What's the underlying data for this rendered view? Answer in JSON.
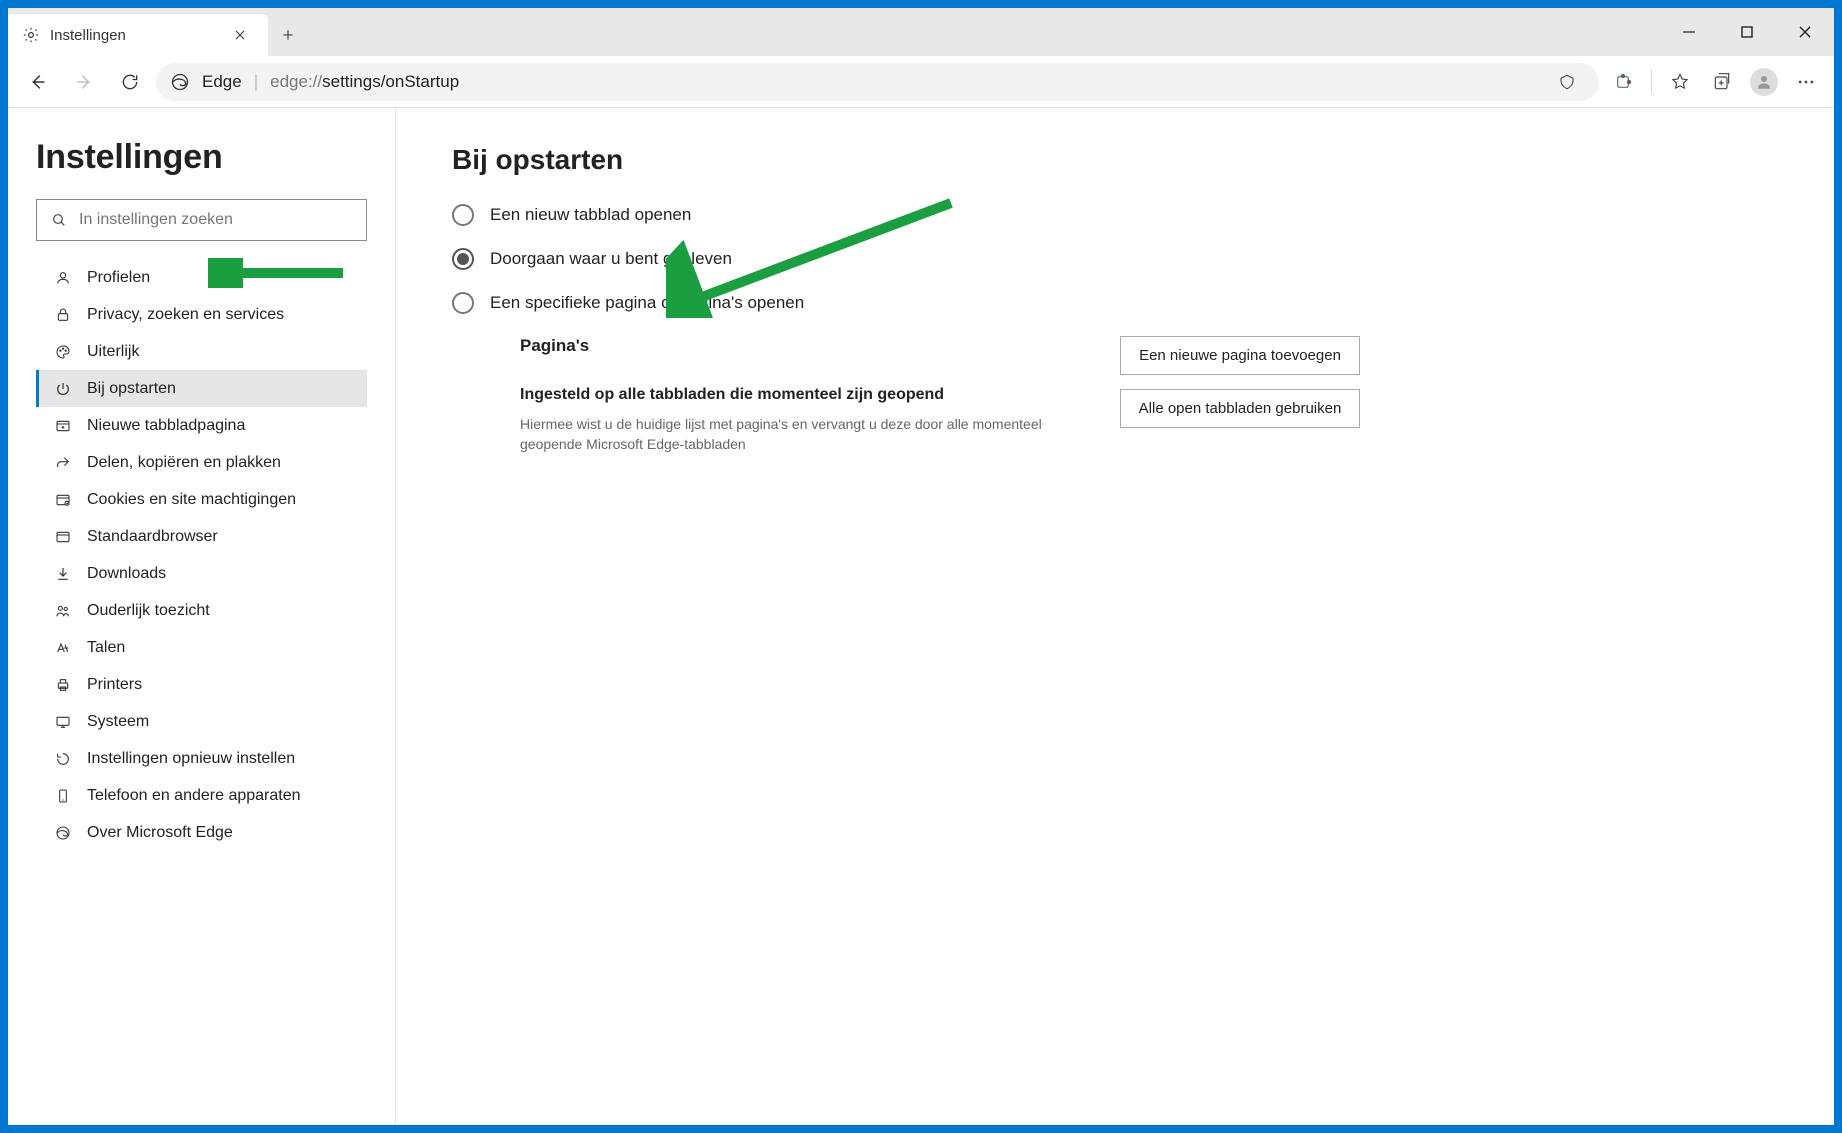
{
  "window": {
    "tab_title": "Instellingen"
  },
  "toolbar": {
    "edge_label": "Edge",
    "url_prefix": "edge://",
    "url_path": "settings/onStartup"
  },
  "sidebar": {
    "title": "Instellingen",
    "search_placeholder": "In instellingen zoeken",
    "items": [
      {
        "icon": "person-icon",
        "label": "Profielen"
      },
      {
        "icon": "lock-icon",
        "label": "Privacy, zoeken en services"
      },
      {
        "icon": "palette-icon",
        "label": "Uiterlijk"
      },
      {
        "icon": "power-icon",
        "label": "Bij opstarten",
        "active": true
      },
      {
        "icon": "newtab-icon",
        "label": "Nieuwe tabbladpagina"
      },
      {
        "icon": "share-icon",
        "label": "Delen, kopiëren en plakken"
      },
      {
        "icon": "cookie-icon",
        "label": "Cookies en site machtigingen"
      },
      {
        "icon": "browser-icon",
        "label": "Standaardbrowser"
      },
      {
        "icon": "download-icon",
        "label": "Downloads"
      },
      {
        "icon": "family-icon",
        "label": "Ouderlijk toezicht"
      },
      {
        "icon": "lang-icon",
        "label": "Talen"
      },
      {
        "icon": "printer-icon",
        "label": "Printers"
      },
      {
        "icon": "system-icon",
        "label": "Systeem"
      },
      {
        "icon": "reset-icon",
        "label": "Instellingen opnieuw instellen"
      },
      {
        "icon": "phone-icon",
        "label": "Telefoon en andere apparaten"
      },
      {
        "icon": "edge-icon",
        "label": "Over Microsoft Edge"
      }
    ]
  },
  "main": {
    "heading": "Bij opstarten",
    "radios": [
      {
        "label": "Een nieuw tabblad openen",
        "selected": false
      },
      {
        "label": "Doorgaan waar u bent gebleven",
        "selected": true
      },
      {
        "label": "Een specifieke pagina of pagina's openen",
        "selected": false
      }
    ],
    "pages_heading": "Pagina's",
    "set_all_heading": "Ingesteld op alle tabbladen die momenteel zijn geopend",
    "set_all_desc": "Hiermee wist u de huidige lijst met pagina's en vervangt u deze door alle momenteel geopende Microsoft Edge-tabbladen",
    "btn_add_page": "Een nieuwe pagina toevoegen",
    "btn_use_all_tabs": "Alle open tabbladen gebruiken"
  }
}
